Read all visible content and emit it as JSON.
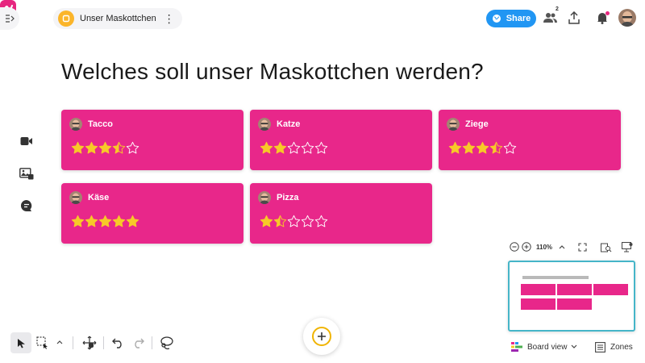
{
  "header": {
    "board_name": "Unser Maskottchen",
    "share_label": "Share",
    "collaborators_count": "2"
  },
  "page": {
    "title": "Welches soll unser Maskottchen werden?"
  },
  "cards": [
    {
      "name": "Tacco",
      "rating": 3.5,
      "max": 5
    },
    {
      "name": "Katze",
      "rating": 2,
      "max": 5
    },
    {
      "name": "Ziege",
      "rating": 3.5,
      "max": 5
    },
    {
      "name": "Käse",
      "rating": 5,
      "max": 5
    },
    {
      "name": "Pizza",
      "rating": 1.5,
      "max": 5
    }
  ],
  "zoom": {
    "level": "110%"
  },
  "footer": {
    "view_label": "Board view",
    "zones_label": "Zones"
  },
  "colors": {
    "card": "#e8278a",
    "star": "#f7c928",
    "share": "#2196f3",
    "add_ring": "#f0b400",
    "minimap_border": "#45b5c8"
  },
  "icons": {
    "left_tools": [
      "video-icon",
      "image-icon",
      "chat-icon"
    ],
    "header": [
      "collapse-icon",
      "app-logo-icon",
      "board-icon",
      "more-icon",
      "globe-icon",
      "users-icon",
      "upload-icon",
      "bell-icon"
    ],
    "toolbar": [
      "pointer-icon",
      "selection-icon",
      "chevron-up-icon",
      "hand-icon",
      "undo-icon",
      "redo-icon",
      "lasso-icon",
      "plus-icon"
    ]
  }
}
